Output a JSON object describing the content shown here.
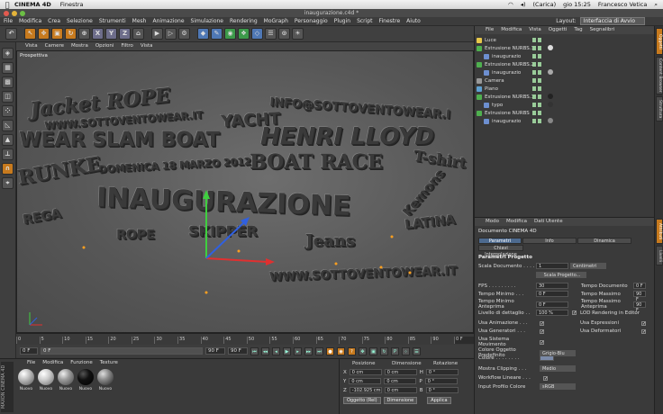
{
  "menubar": {
    "app": "CINEMA 4D",
    "items": [
      "Finestra"
    ],
    "battery": "(Carica)",
    "time": "gio 15:25",
    "user": "Francesco Vetica"
  },
  "window": {
    "title": "inaugurazione.c4d *"
  },
  "mainmenu": {
    "items": [
      "File",
      "Modifica",
      "Crea",
      "Selezione",
      "Strumenti",
      "Mesh",
      "Animazione",
      "Simulazione",
      "Rendering",
      "MoGraph",
      "Personaggio",
      "Plugin",
      "Script",
      "Finestre",
      "Aiuto"
    ],
    "layout_label": "Layout:",
    "layout_value": "Interfaccia di Avvio"
  },
  "toolbar": {
    "axis_x": "X",
    "axis_y": "Y",
    "axis_z": "Z"
  },
  "viewport": {
    "menu": [
      "Vista",
      "Camere",
      "Mostra",
      "Opzioni",
      "Filtro",
      "Vista"
    ],
    "label": "Prospettiva",
    "scene_text": {
      "t1": "Jacket ROPE",
      "t2": "WWW.SOTTOVENTOWEAR.IT",
      "t3": "YACHT",
      "t4": "INFO@SOTTOVENTOWEAR.I",
      "t5": "WEAR SLAM BOAT",
      "t6": "HENRI LLOYD",
      "t7": "DOMENICA 18 MARZO 2012",
      "t8": "BOAT RACE",
      "t9": "INAUGURAZIONE",
      "t10": "SKIPPER",
      "t11": "ROPE",
      "t12": "LATINA",
      "t13": "WWW.SOTTOVENTOWEAR.IT",
      "t14": "T-shirt",
      "t15": "Jeans",
      "t16": "Kemons",
      "t17": "RUNKE",
      "t18": "REGA"
    }
  },
  "timeline": {
    "ticks": [
      "0",
      "5",
      "10",
      "15",
      "20",
      "25",
      "30",
      "35",
      "40",
      "45",
      "50",
      "55",
      "60",
      "65",
      "70",
      "75",
      "80",
      "85",
      "90"
    ],
    "end_label": "0 F",
    "start_frame": "0 F",
    "current_frame": "0 F",
    "min_frame": "90 F",
    "max_frame": "90 F"
  },
  "materials": {
    "menu": [
      "File",
      "Modifica",
      "Funzione",
      "Texture"
    ],
    "items": [
      {
        "label": "Nuovo"
      },
      {
        "label": "Nuovo"
      },
      {
        "label": "Nuovo"
      },
      {
        "label": "Nuovo"
      },
      {
        "label": "Nuovo"
      }
    ],
    "brand": "MAXON CINEMA 4D"
  },
  "coordinates": {
    "headers": [
      "Posizione",
      "Dimensione",
      "Rotazione"
    ],
    "rows": [
      {
        "axis": "X",
        "pos": "0 cm",
        "dim": "0 cm",
        "rot_axis": "H",
        "rot": "0 °"
      },
      {
        "axis": "Y",
        "pos": "0 cm",
        "dim": "0 cm",
        "rot_axis": "P",
        "rot": "0 °"
      },
      {
        "axis": "Z",
        "pos": "-102.925 cm",
        "dim": "0 cm",
        "rot_axis": "B",
        "rot": "0 °"
      }
    ],
    "mode": "Oggetto (Rel)",
    "size_mode": "Dimensione",
    "apply": "Applica"
  },
  "objects": {
    "menu": [
      "File",
      "Modifica",
      "Vista",
      "Oggetti",
      "Tag",
      "Segnalibri"
    ],
    "items": [
      {
        "name": "Luce",
        "color": "#e8c84a",
        "indent": 0
      },
      {
        "name": "Estrusione NURBS.3",
        "color": "#4fb04f",
        "indent": 0
      },
      {
        "name": "inaugurazio",
        "color": "#6d8fd0",
        "indent": 1
      },
      {
        "name": "Estrusione NURBS.2",
        "color": "#4fb04f",
        "indent": 0
      },
      {
        "name": "inaugurazio",
        "color": "#6d8fd0",
        "indent": 1
      },
      {
        "name": "Camera",
        "color": "#999999",
        "indent": 0
      },
      {
        "name": "Piano",
        "color": "#5fa0d0",
        "indent": 0
      },
      {
        "name": "Estrusione NURBS.1",
        "color": "#4fb04f",
        "indent": 0
      },
      {
        "name": "typo",
        "color": "#6d8fd0",
        "indent": 1
      },
      {
        "name": "Estrusione NURBS",
        "color": "#4fb04f",
        "indent": 0
      },
      {
        "name": "inaugurazio",
        "color": "#6d8fd0",
        "indent": 1
      }
    ]
  },
  "attributes": {
    "menu": [
      "Modo",
      "Modifica",
      "Dati Utente"
    ],
    "doc_title": "Documento CINEMA 4D",
    "tabs": [
      "Parametri Progetto",
      "Info",
      "Dinamica"
    ],
    "subtab": "Chiavi Interpolazione",
    "section": "Parametri Progetto",
    "scale_label": "Scala Documento . . . .",
    "scale_value": "1",
    "scale_unit": "Centimetri",
    "scale_button": "Scala Progetto...",
    "fps_label": "FPS . . . . . . . . .",
    "fps_value": "30",
    "tempo_doc_label": "Tempo Documento",
    "tempo_doc_value": "0 F",
    "tempo_min_label": "Tempo Minimo . . .",
    "tempo_min_value": "0 F",
    "tempo_max_label": "Tempo Massimo",
    "tempo_max_value": "90 F",
    "tempo_min_ant_label": "Tempo Minimo Anteprima",
    "tempo_min_ant_value": "0 F",
    "tempo_max_ant_label": "Tempo Massimo Anteprima",
    "tempo_max_ant_value": "90 F",
    "lod_label": "Livello di dettaglio . .",
    "lod_value": "100 %",
    "lod_render_label": "LOD Rendering in Editor",
    "usa_anim": "Usa Animazione . . .",
    "usa_espr": "Usa Espressioni",
    "usa_gen": "Usa Generatori . . .",
    "usa_def": "Usa Deformatori",
    "usa_sist": "Usa Sistema Movimento",
    "colore_pred_label": "Colore Oggetto Predefinito",
    "colore_pred_value": "Grigio-Blu",
    "colore_label": "Colore . . . . . . . .",
    "clipping_label": "Mostra Clipping . . .",
    "clipping_value": "Medio",
    "workflow_label": "Workflow Lineare . . .",
    "input_label": "Input Profilo Colore",
    "input_value": "sRGB",
    "check_mark": "✓"
  },
  "vtabs": [
    "Oggetti",
    "Content Browser",
    "Struttura",
    "Attributi",
    "Livelli"
  ]
}
